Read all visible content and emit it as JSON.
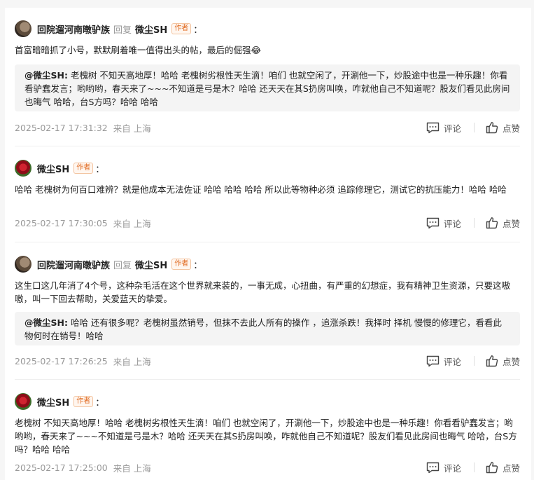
{
  "comments": [
    {
      "user": "回院遛河南暾驴族",
      "reply_word": "回复",
      "reply_to": "微尘SH",
      "author_badge": "作者",
      "colon": "：",
      "text": "首富暗暗抓了小号，默默刷着唯一值得出头的帖，最后的倔强😂",
      "quote_name": "@微尘SH:",
      "quote_text": " 老槐树 不知天高地厚！哈哈 老槐树劣根性天生滴！咱们 也就空闲了，开涮他一下，炒股途中也是一种乐趣！你看看驴蠢发言；哟哟哟，春天来了~~~不知道是弓是木？哈哈 还天天在其S扔房叫唤，咋就他自己不知道呢？股友们看见此房间也晦气 哈哈，台S方吗？哈哈 哈哈",
      "time": "2025-02-17 17:31:32",
      "location": "来自 上海",
      "comment_label": "评论",
      "like_label": "点赞"
    },
    {
      "user": "微尘SH",
      "author_badge": "作者",
      "colon": "：",
      "text": "哈哈 老槐树为何百口难辨？就是他成本无法佐证 哈哈 哈哈 哈哈 所以此等物种必须 追踪修理它，测试它的抗压能力！哈哈 哈哈",
      "time": "2025-02-17 17:30:05",
      "location": "来自 上海",
      "comment_label": "评论",
      "like_label": "点赞"
    },
    {
      "user": "回院遛河南暾驴族",
      "reply_word": "回复",
      "reply_to": "微尘SH",
      "author_badge": "作者",
      "colon": "：",
      "text": "这生口这几年消了4个号，这种杂毛活在这个世界就来装的，一事无成，心扭曲，有严重的幻想症，我有精神卫生资源，只要这嗷嗷，叫一下回去帮助，关爱蓝天的挚爱。",
      "quote_name": "@微尘SH:",
      "quote_text": " 哈哈 还有很多呢？老槐树虽然销号，但抹不去此人所有的操作 ，追涨杀跌！我择时 择机 慢慢的修理它，看看此物何时在销号！哈哈",
      "time": "2025-02-17 17:26:25",
      "location": "来自 上海",
      "comment_label": "评论",
      "like_label": "点赞"
    },
    {
      "user": "微尘SH",
      "author_badge": "作者",
      "colon": "：",
      "text": "老槐树 不知天高地厚！哈哈 老槐树劣根性天生滴！咱们 也就空闲了，开涮他一下，炒股途中也是一种乐趣！你看看驴蠢发言；哟哟哟，春天来了~~~不知道是弓是木？哈哈 还天天在其S扔房叫唤，咋就他自己不知道呢？股友们看见此房间也晦气 哈哈，台S方吗？哈哈 哈哈",
      "time": "2025-02-17 17:25:00",
      "location": "来自 上海",
      "comment_label": "评论",
      "like_label": "点赞"
    }
  ]
}
